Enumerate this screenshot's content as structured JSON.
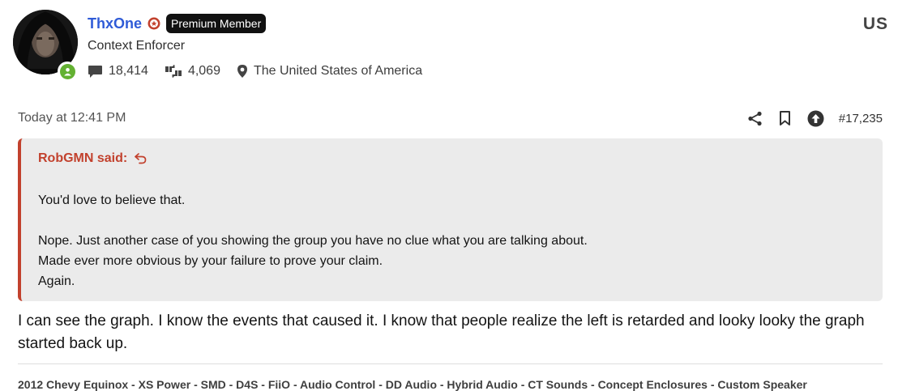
{
  "user": {
    "name": "ThxOne",
    "badge": "Premium Member",
    "title": "Context Enforcer",
    "messages": "18,414",
    "reactions": "4,069",
    "location": "The United States of America",
    "flag": "US"
  },
  "post": {
    "date": "Today at 12:41 PM",
    "number": "#17,235",
    "quote": {
      "attribution": "RobGMN said:",
      "lines": [
        "You'd love to believe that.",
        "Nope. Just another case of you showing the group you have no clue what you are talking about.",
        "Made ever more obvious by your failure to prove your claim.",
        "Again."
      ]
    },
    "body": "I can see the graph. I know the events that caused it. I know that people realize the left is retarded and looky looky the graph started back up."
  },
  "signature": "2012 Chevy Equinox - XS Power - SMD - D4S - FiiO - Audio Control - DD Audio - Hybrid Audio - CT Sounds - Concept Enclosures - Custom Speaker",
  "colors": {
    "username": "#2f5bd7",
    "quote_accent": "#c2412d",
    "online": "#63b132",
    "badge_bg": "#111111"
  },
  "icons": [
    "avatar-image",
    "online-status-icon",
    "staff-star-icon",
    "message-bubble-icon",
    "thumbs-reaction-icon",
    "location-pin-icon",
    "share-icon",
    "bookmark-icon",
    "upvote-icon",
    "quote-jump-icon"
  ]
}
